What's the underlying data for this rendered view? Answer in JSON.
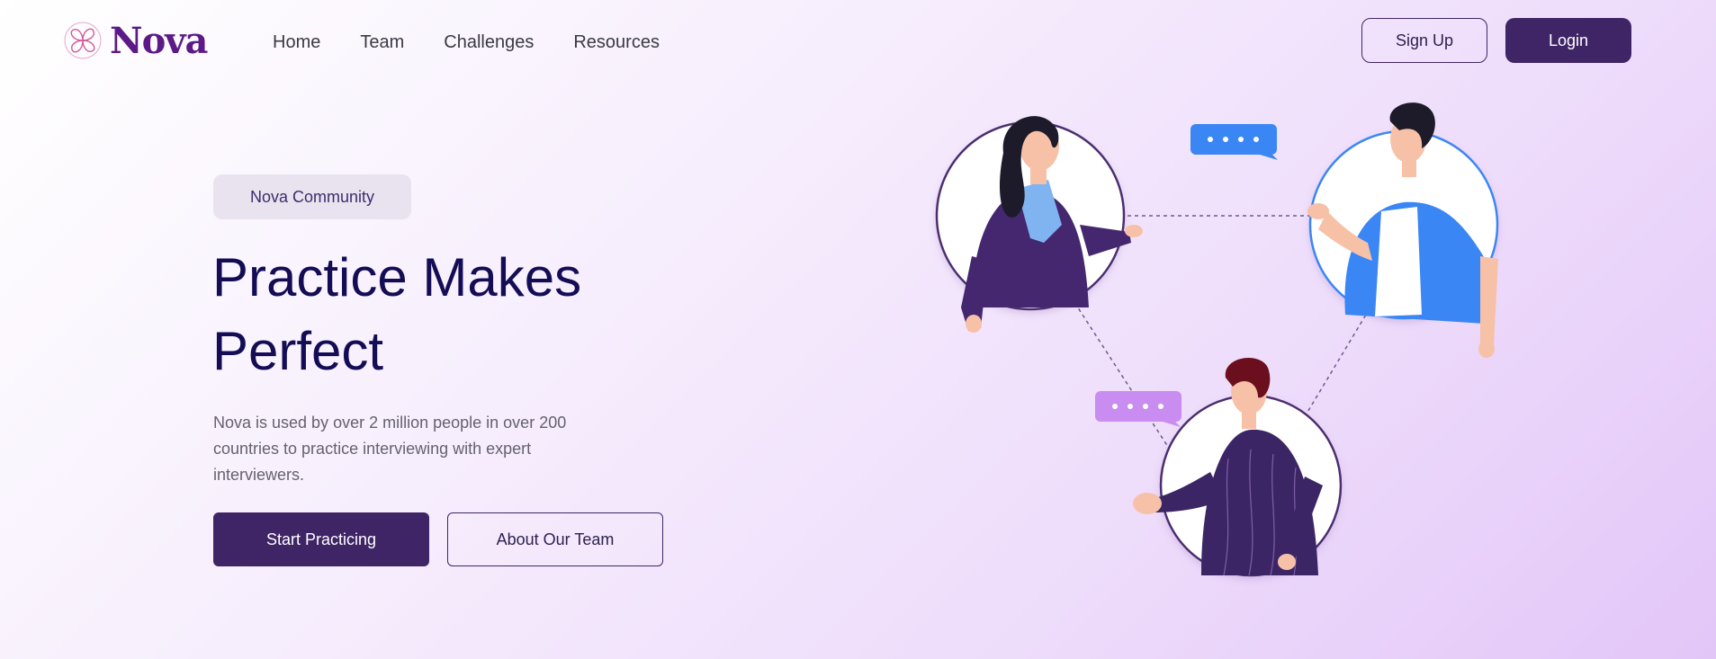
{
  "brand": {
    "name": "Nova",
    "logo_icon": "flower-logo-icon"
  },
  "nav": {
    "items": [
      "Home",
      "Team",
      "Challenges",
      "Resources"
    ]
  },
  "auth": {
    "signup_label": "Sign Up",
    "login_label": "Login"
  },
  "hero": {
    "badge": "Nova Community",
    "title": "Practice Makes Perfect",
    "description": "Nova is used by over 2 million people in over 200 countries to practice interviewing with expert interviewers.",
    "primary_cta": "Start Practicing",
    "secondary_cta": "About Our Team"
  },
  "illustration": {
    "icon": "community-network-illustration"
  },
  "colors": {
    "primary": "#402566",
    "heading": "#140d55",
    "brand": "#5b1a86",
    "accent_blue": "#3a86f5",
    "accent_violet": "#c98cf0"
  }
}
